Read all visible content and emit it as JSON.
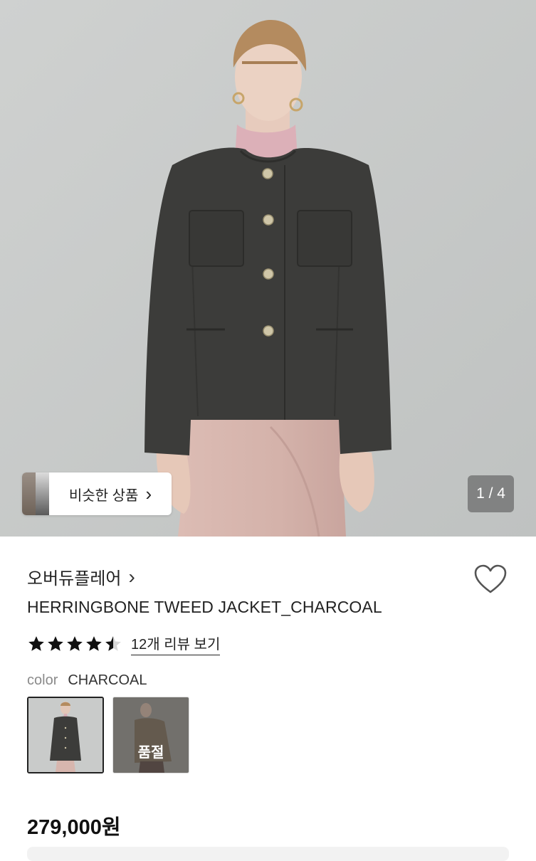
{
  "gallery": {
    "pager": "1 / 4",
    "similar_label": "비슷한 상품",
    "similar_chevron": "›"
  },
  "product": {
    "brand": "오버듀플레어",
    "brand_chevron": "›",
    "title": "HERRINGBONE TWEED JACKET_CHARCOAL",
    "rating": 4.5,
    "review_link": "12개 리뷰 보기",
    "color_label": "color",
    "color_value": "CHARCOAL",
    "soldout_label": "품절",
    "price": "279,000원"
  },
  "icons": [
    "heart-icon",
    "star-icon",
    "chevron-right-icon"
  ],
  "colors": {
    "background": "#ffffff",
    "text": "#222222",
    "muted": "#8a8a8a",
    "pager_bg": "#5a5a5a",
    "wall": "#c9cccb",
    "jacket": "#3c3c3a",
    "skirt": "#d8b8b0"
  }
}
